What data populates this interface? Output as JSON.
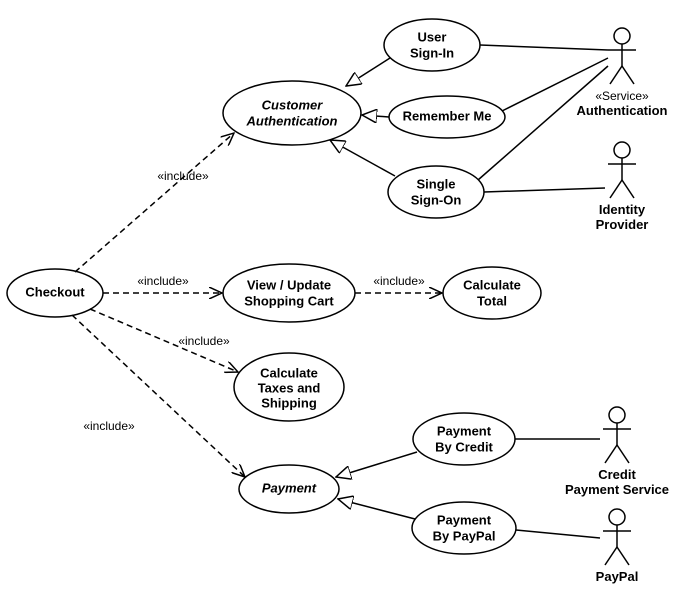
{
  "diagram_type": "UML use case diagram",
  "usecases": {
    "checkout": {
      "label": "Checkout"
    },
    "auth": {
      "label1": "Customer",
      "label2": "Authentication",
      "abstract": true
    },
    "signin": {
      "label1": "User",
      "label2": "Sign-In"
    },
    "remember": {
      "label": "Remember Me"
    },
    "sso": {
      "label1": "Single",
      "label2": "Sign-On"
    },
    "cart": {
      "label1": "View / Update",
      "label2": "Shopping Cart"
    },
    "calc_total": {
      "label1": "Calculate",
      "label2": "Total"
    },
    "calc_tax": {
      "label1": "Calculate",
      "label2": "Taxes and",
      "label3": "Shipping"
    },
    "payment": {
      "label": "Payment",
      "abstract": true
    },
    "pay_credit": {
      "label1": "Payment",
      "label2": "By Credit"
    },
    "pay_paypal": {
      "label1": "Payment",
      "label2": "By PayPal"
    }
  },
  "actors": {
    "auth_service": {
      "stereotype": "«Service»",
      "label": "Authentication"
    },
    "idp": {
      "label1": "Identity",
      "label2": "Provider"
    },
    "credit": {
      "label1": "Credit",
      "label2": "Payment Service"
    },
    "paypal": {
      "label": "PayPal"
    }
  },
  "stereotypes": {
    "include": "«include»"
  }
}
